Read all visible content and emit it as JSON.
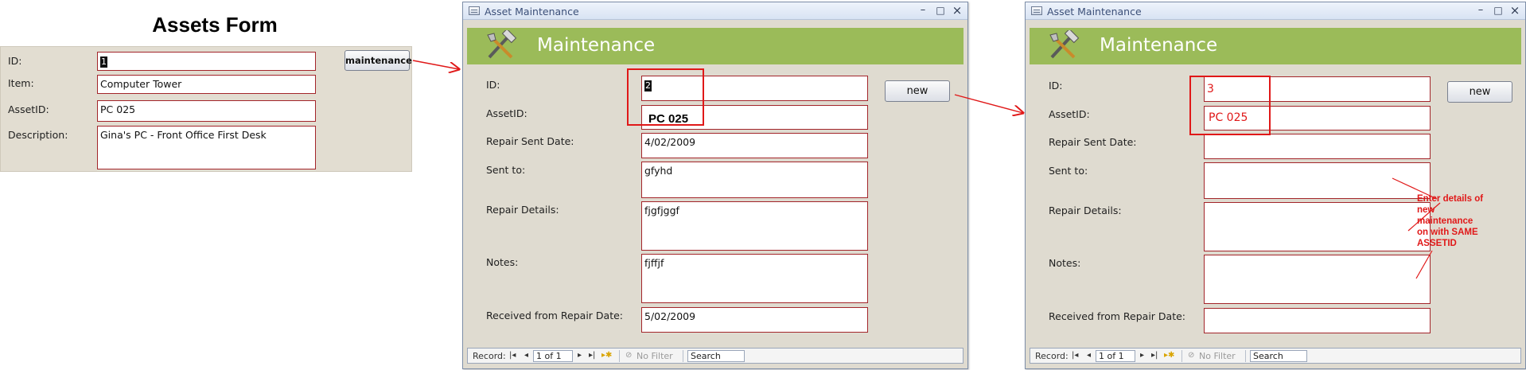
{
  "assets_form": {
    "title": "Assets Form",
    "labels": {
      "id": "ID:",
      "item": "Item:",
      "asset_id": "AssetID:",
      "description": "Description:"
    },
    "values": {
      "id": "1",
      "item": "Computer Tower",
      "asset_id": "PC 025",
      "description": "Gina's PC - Front Office First Desk"
    },
    "maintenance_button": "maintenance"
  },
  "window1": {
    "title": "Asset Maintenance",
    "controls": {
      "minimize": "–",
      "maximize": "□",
      "close": "×"
    },
    "header": "Maintenance",
    "labels": {
      "id": "ID:",
      "asset_id": "AssetID:",
      "repair_sent_date": "Repair Sent Date:",
      "sent_to": "Sent to:",
      "repair_details": "Repair Details:",
      "notes": "Notes:",
      "received_date": "Received from Repair Date:"
    },
    "values": {
      "id": "2",
      "asset_id": "PC 025",
      "repair_sent_date": "4/02/2009",
      "sent_to": "gfyhd",
      "repair_details": "fjgfjggf",
      "notes": "fjffjf",
      "received_date": "5/02/2009"
    },
    "new_button": "new",
    "navigation": {
      "record_label": "Record:",
      "position": "1 of 1",
      "filter": "No Filter",
      "search": "Search"
    }
  },
  "window2": {
    "title": "Asset Maintenance",
    "controls": {
      "minimize": "–",
      "maximize": "□",
      "close": "×"
    },
    "header": "Maintenance",
    "labels": {
      "id": "ID:",
      "asset_id": "AssetID:",
      "repair_sent_date": "Repair Sent Date:",
      "sent_to": "Sent to:",
      "repair_details": "Repair Details:",
      "notes": "Notes:",
      "received_date": "Received from Repair Date:"
    },
    "values": {
      "id": "3",
      "asset_id": "PC 025",
      "repair_sent_date": "",
      "sent_to": "",
      "repair_details": "",
      "notes": "",
      "received_date": ""
    },
    "new_button": "new",
    "navigation": {
      "record_label": "Record:",
      "position": "1 of 1",
      "filter": "No Filter",
      "search": "Search"
    }
  },
  "annotation": {
    "lines": [
      "Enter details of",
      "new",
      "maintenance",
      "on with SAME",
      "ASSETID"
    ]
  },
  "colors": {
    "field_border": "#a3252a",
    "header_green": "#9bbb59",
    "form_background": "#dfdbd0",
    "annotation_red": "#e01818"
  }
}
